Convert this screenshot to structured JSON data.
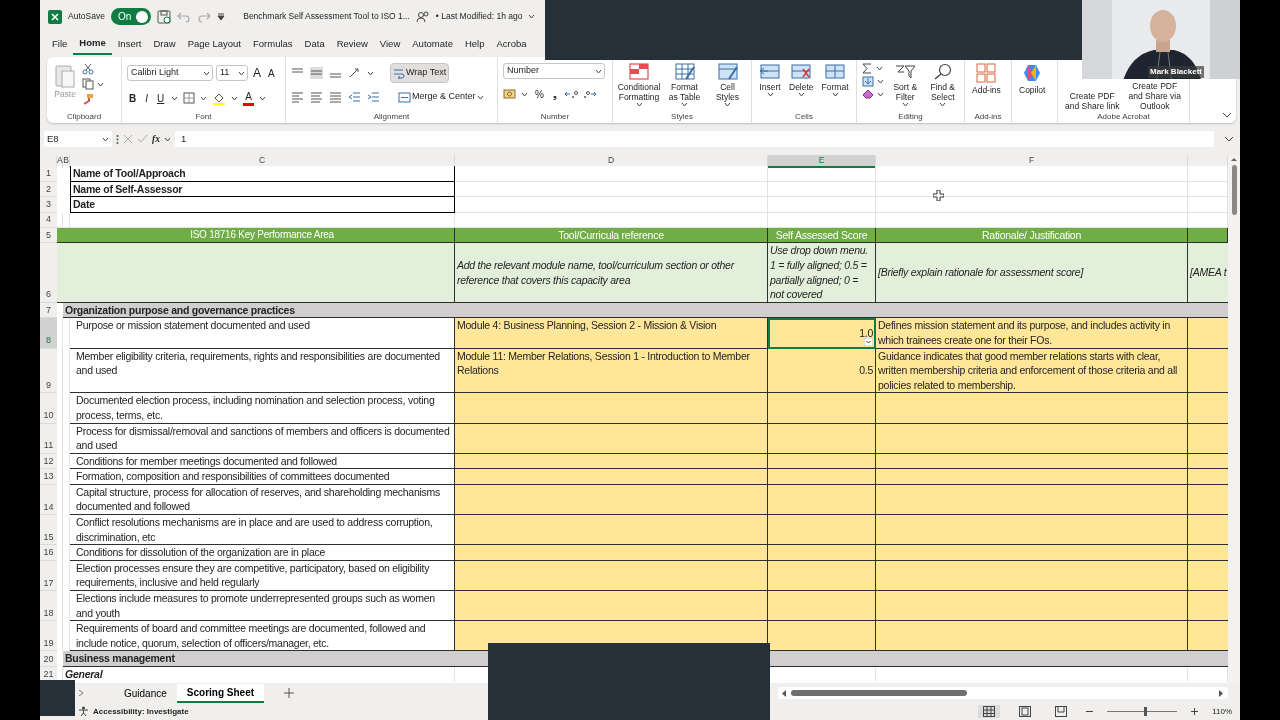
{
  "title_bar": {
    "autosave_label": "AutoSave",
    "autosave": {
      "on": true,
      "text": "On"
    },
    "file_name": "Benchmark Self Assessment Tool to ISO 1...",
    "last_modified": "• Last Modified: 1h ago"
  },
  "ribbon_tabs": [
    {
      "label": "File",
      "selected": false
    },
    {
      "label": "Home",
      "selected": true
    },
    {
      "label": "Insert",
      "selected": false
    },
    {
      "label": "Draw",
      "selected": false
    },
    {
      "label": "Page Layout",
      "selected": false
    },
    {
      "label": "Formulas",
      "selected": false
    },
    {
      "label": "Data",
      "selected": false
    },
    {
      "label": "Review",
      "selected": false
    },
    {
      "label": "View",
      "selected": false
    },
    {
      "label": "Automate",
      "selected": false
    },
    {
      "label": "Help",
      "selected": false
    },
    {
      "label": "Acroba",
      "selected": false
    }
  ],
  "clipboard": {
    "paste": "Paste",
    "label": "Clipboard"
  },
  "font": {
    "name": "Calibri Light",
    "size": "11",
    "grow": "A",
    "shrink": "A",
    "bold": "B",
    "italic": "I",
    "underline": "U",
    "color_letter": "A",
    "label": "Font"
  },
  "alignment": {
    "wrap_text": {
      "label": "Wrap Text",
      "on": true
    },
    "merge": "Merge & Center",
    "label": "Alignment"
  },
  "number": {
    "format": "Number",
    "percent": "%",
    "comma": "❟",
    "label": "Number"
  },
  "styles": {
    "buttons": [
      "Conditional Formatting",
      "Format as Table",
      "Cell Styles"
    ],
    "label": "Styles"
  },
  "cells": {
    "buttons": [
      "Insert",
      "Delete",
      "Format"
    ],
    "label": "Cells"
  },
  "editing": {
    "buttons": [
      "Sort & Filter",
      "Find & Select"
    ],
    "label": "Editing"
  },
  "addins": {
    "button": "Add-ins",
    "label": "Add-ins"
  },
  "copilot": {
    "button": "Copilot"
  },
  "acrobat": {
    "buttons": [
      "Create PDF and Share link",
      "Create PDF and Share via Outlook"
    ],
    "label": "Adobe Acrobat"
  },
  "webcam": {
    "participant": "Mark Blackett"
  },
  "formula_bar": {
    "name_box": "E8",
    "function_label": "fx",
    "value": "1"
  },
  "columns": [
    {
      "label": "A",
      "selected": false
    },
    {
      "label": "B",
      "selected": false
    },
    {
      "label": "C",
      "selected": false
    },
    {
      "label": "D",
      "selected": false
    },
    {
      "label": "E",
      "selected": true
    },
    {
      "label": "F",
      "selected": false
    }
  ],
  "rows": [
    {
      "number": "1",
      "kind": "info",
      "label": "Name of Tool/Approach",
      "selected": false
    },
    {
      "number": "2",
      "kind": "info",
      "label": "Name of Self-Assessor",
      "selected": false
    },
    {
      "number": "3",
      "kind": "info",
      "label": "Date",
      "selected": false
    },
    {
      "number": "4",
      "kind": "blank",
      "selected": false
    },
    {
      "number": "5",
      "kind": "header",
      "area": "ISO 18716 Key Performance Area",
      "reference": "Tool/Curricula reference",
      "score": "Self Assessed Score",
      "rationale": "Rationale/ Justification",
      "selected": false
    },
    {
      "number": "6",
      "kind": "guide",
      "reference": "Add the relevant module name, tool/curriculum section or other reference that covers this capacity area",
      "score": "Use drop down menu. 1 = fully aligned; 0.5 = partially aligned; 0 = not covered",
      "rationale": "[Briefly explain rationale for assessment score]",
      "column_g": "[AMEA t",
      "selected": false
    },
    {
      "number": "7",
      "kind": "section",
      "label": "Organization purpose and governance practices",
      "selected": false
    },
    {
      "number": "8",
      "kind": "item",
      "area": "Purpose or mission statement documented and used",
      "reference": "Module 4: Business Planning, Session 2 - Mission & Vision",
      "score": "1.0",
      "rationale": "Defines mission statement and its purpose, and includes activity in which trainees create one for their FOs.",
      "selected": true
    },
    {
      "number": "9",
      "kind": "item",
      "area": "Member eligibility criteria, requirements, rights and responsibilities are documented and used",
      "reference": "Module 11: Member Relations, Session 1 - Introduction to Member Relations",
      "score": "0.5",
      "rationale": "Guidance indicates that good member relations starts with clear, written membership criteria and enforcement of those criteria and all policies related to membership.",
      "selected": false
    },
    {
      "number": "10",
      "kind": "item",
      "area": "Documented election process, including nomination and selection process, voting process, terms, etc.",
      "selected": false
    },
    {
      "number": "11",
      "kind": "item",
      "area": "Process for dismissal/removal and sanctions of members and officers is documented and used",
      "selected": false
    },
    {
      "number": "12",
      "kind": "item",
      "area": "Conditions for member meetings documented and followed",
      "selected": false
    },
    {
      "number": "13",
      "kind": "item",
      "area": "Formation, composition and responsibilities of committees documented",
      "selected": false
    },
    {
      "number": "14",
      "kind": "item",
      "area": "Capital structure, process for allocation of reserves, and shareholding mechanisms documented and followed",
      "selected": false
    },
    {
      "number": "15",
      "kind": "item",
      "area": "Conflict resolutions mechanisms are in place and are used to address corruption, discrimination, etc",
      "selected": false
    },
    {
      "number": "16",
      "kind": "item",
      "area": "Conditions for dissolution of the organization are in place",
      "selected": false
    },
    {
      "number": "17",
      "kind": "item",
      "area": "Election processes ensure they are competitive, participatory, based on eligibility requirements, inclusive and held regularly",
      "selected": false
    },
    {
      "number": "18",
      "kind": "item",
      "area": "Elections include measures to promote underrepresented groups such as women and youth",
      "selected": false
    },
    {
      "number": "19",
      "kind": "item",
      "area": "Requirements of board and committee meetings are documented, followed and include notice, quorum, selection of officers/manager, etc.",
      "selected": false
    },
    {
      "number": "20",
      "kind": "section",
      "label": "Business management",
      "selected": false
    },
    {
      "number": "21",
      "kind": "subsection",
      "label": "General",
      "selected": false
    }
  ],
  "sheet_tabs": [
    {
      "label": "Guidance",
      "selected": false
    },
    {
      "label": "Scoring Sheet",
      "selected": true
    }
  ],
  "status_bar": {
    "accessibility": "Accessibility: Investigate",
    "zoom": {
      "level": 0.52,
      "text": "110%"
    }
  }
}
